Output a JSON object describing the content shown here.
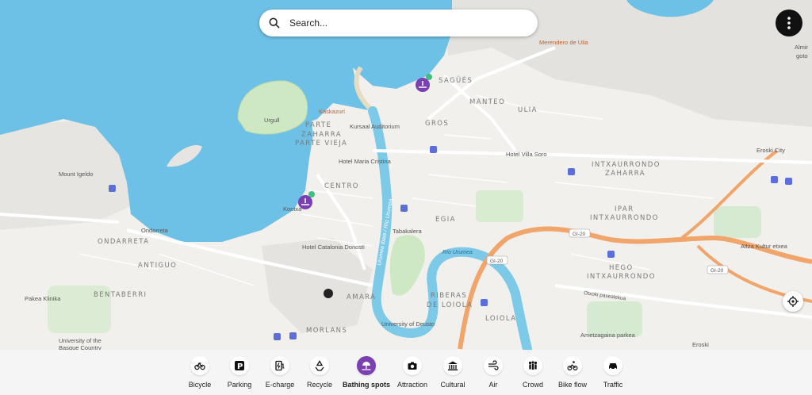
{
  "search": {
    "placeholder": "Search..."
  },
  "map": {
    "districts": [
      "SAGÜÉS",
      "MANTEO",
      "ULIA",
      "GROS",
      "PARTE",
      "ZAHARRA",
      "PARTE VIEJA",
      "CENTRO",
      "EGIA",
      "INTXAURRONDO",
      "ZAHARRA",
      "IPAR",
      "INTXAURRONDO",
      "HEGO",
      "INTXAURRONDO",
      "ONDARRETA",
      "ANTIGUO",
      "BENTABERRI",
      "AMARA",
      "RIBERAS",
      "DE LOIOLA",
      "LOIOLA",
      "MORLANS"
    ],
    "places": [
      "Merendero de Ulia",
      "Kaskazuri",
      "Urgull",
      "Kursaal Auditorium",
      "Hotel Maria Cristina",
      "Hotel Villa Soro",
      "Eroski City",
      "Mount Igeldo",
      "Ondarreta",
      "Kontxa",
      "Tabakalera",
      "Hotel Catalonia Donosti",
      "Pakea Klinika",
      "University of the Basque Country",
      "University of Deusto",
      "Ametzagaina parkea",
      "Altza Kultur etxea",
      "Eroski",
      "Almir",
      "goto"
    ],
    "roads": [
      "GI-20",
      "GI-20",
      "GI-20",
      "Otxoki pasealekua"
    ],
    "water": [
      "Urumea ibaia / Río Urumea",
      "Río Urumea"
    ]
  },
  "categories": [
    {
      "label": "Bicycle",
      "icon": "bicycle-icon"
    },
    {
      "label": "Parking",
      "icon": "parking-icon"
    },
    {
      "label": "E-charge",
      "icon": "charging-station-icon"
    },
    {
      "label": "Recycle",
      "icon": "recycle-icon"
    },
    {
      "label": "Bathing spots",
      "icon": "beach-umbrella-icon",
      "active": true
    },
    {
      "label": "Attraction",
      "icon": "camera-icon"
    },
    {
      "label": "Cultural",
      "icon": "museum-icon"
    },
    {
      "label": "Air",
      "icon": "wind-icon"
    },
    {
      "label": "Crowd",
      "icon": "people-icon"
    },
    {
      "label": "Bike flow",
      "icon": "bicycle-flow-icon"
    },
    {
      "label": "Traffic",
      "icon": "car-icon"
    }
  ],
  "colors": {
    "sea": "#6ec1e6",
    "land": "#f1f0ec",
    "park": "#cfe8c4",
    "highway": "#f2a56b",
    "accent": "#7a3fb0",
    "metro": "#5b6ed9"
  }
}
